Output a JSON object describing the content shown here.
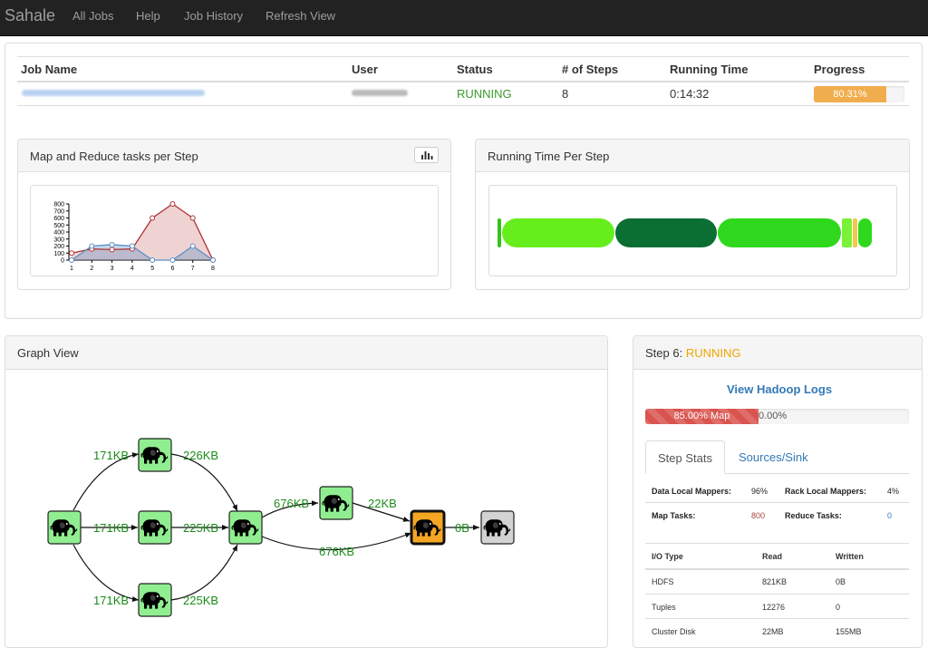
{
  "nav": {
    "brand": "Sahale",
    "items": [
      "All Jobs",
      "Help",
      "Job History",
      "Refresh View"
    ]
  },
  "job_table": {
    "headers": [
      "Job Name",
      "User",
      "Status",
      "# of Steps",
      "Running Time",
      "Progress"
    ],
    "row": {
      "status": "RUNNING",
      "steps": "8",
      "running_time": "0:14:32",
      "progress_label": "80.31%",
      "progress_value": 0.8031
    }
  },
  "map_reduce_panel": {
    "title": "Map and Reduce tasks per Step",
    "toggle_icon": "bar-chart-icon"
  },
  "chart_data": {
    "type": "area",
    "x": [
      1,
      2,
      3,
      4,
      5,
      6,
      7,
      8
    ],
    "ylim": [
      0,
      800
    ],
    "yticks": [
      0,
      100,
      200,
      300,
      400,
      500,
      600,
      700,
      800
    ],
    "series": [
      {
        "values": [
          100,
          160,
          150,
          160,
          600,
          800,
          600,
          0
        ],
        "color": "#b03030"
      },
      {
        "values": [
          0,
          200,
          220,
          200,
          0,
          0,
          200,
          0
        ],
        "color": "#5b8ec4"
      }
    ]
  },
  "running_time_panel": {
    "title": "Running Time Per Step",
    "segments": [
      {
        "fraction": 0.013,
        "color": "#37c21b"
      },
      {
        "fraction": 0.295,
        "color": "#66ee1c"
      },
      {
        "fraction": 0.267,
        "color": "#0b6e33"
      },
      {
        "fraction": 0.325,
        "color": "#2fd81c"
      },
      {
        "fraction": 0.03,
        "color": "#7cf13a"
      },
      {
        "fraction": 0.012,
        "color": "#f2c94c"
      },
      {
        "fraction": 0.04,
        "color": "#2fd81c"
      }
    ]
  },
  "graph": {
    "title": "Graph View",
    "icon": "hadoop-elephant-icon",
    "edges": [
      {
        "label": "171KB"
      },
      {
        "label": "226KB"
      },
      {
        "label": "171KB"
      },
      {
        "label": "225KB"
      },
      {
        "label": "171KB"
      },
      {
        "label": "225KB"
      },
      {
        "label": "676KB"
      },
      {
        "label": "22KB"
      },
      {
        "label": "676KB"
      },
      {
        "label": "0B"
      }
    ],
    "colors": {
      "done": "#90ee90",
      "running": "#f5a623",
      "pending": "#d3d3d3"
    }
  },
  "step": {
    "prefix": "Step 6:",
    "status": "RUNNING",
    "logs_link": "View Hadoop Logs",
    "map_label": "85.00% Map",
    "map_value": 0.85,
    "reduce_label": "0.00%",
    "tabs": [
      "Step Stats",
      "Sources/Sink"
    ],
    "stats": {
      "data_local_mappers_label": "Data Local Mappers:",
      "data_local_mappers": "96%",
      "rack_local_mappers_label": "Rack Local Mappers:",
      "rack_local_mappers": "4%",
      "map_tasks_label": "Map Tasks:",
      "map_tasks": "800",
      "reduce_tasks_label": "Reduce Tasks:",
      "reduce_tasks": "0"
    },
    "io": {
      "headers": [
        "I/O Type",
        "Read",
        "Written"
      ],
      "rows": [
        [
          "HDFS",
          "821KB",
          "0B"
        ],
        [
          "Tuples",
          "12276",
          "0"
        ],
        [
          "Cluster Disk",
          "22MB",
          "155MB"
        ]
      ]
    }
  }
}
